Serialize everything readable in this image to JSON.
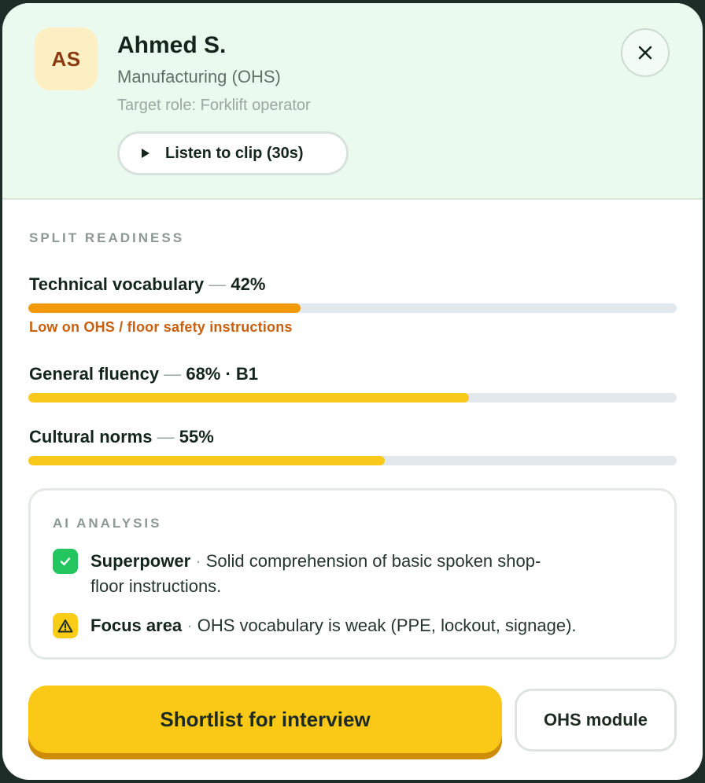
{
  "candidate": {
    "initials": "AS",
    "name": "Ahmed S.",
    "department": "Manufacturing (OHS)",
    "target_role": "Target role: Forklift operator",
    "listen_label": "Listen to clip (30s)"
  },
  "readiness": {
    "title": "SPLIT READINESS",
    "metrics": [
      {
        "label": "Technical vocabulary",
        "dash": "—",
        "value_text": "42%",
        "percent": 42,
        "color": "#f29a0c",
        "note": "Low on OHS / floor safety instructions"
      },
      {
        "label": "General fluency",
        "dash": "—",
        "value_text": "68% · B1",
        "percent": 68,
        "color": "#f9c91b"
      },
      {
        "label": "Cultural norms",
        "dash": "—",
        "value_text": "55%",
        "percent": 55,
        "color": "#f9c91b"
      }
    ]
  },
  "analysis": {
    "title": "AI ANALYSIS",
    "items": [
      {
        "icon": "check-icon",
        "heading": "Superpower",
        "sep": "·",
        "line1": "Solid comprehension of basic spoken shop-",
        "line2": "floor instructions.",
        "badge_color": "#22c55e"
      },
      {
        "icon": "warning-icon",
        "heading": "Focus area",
        "sep": "·",
        "line1": "OHS vocabulary is weak (PPE, lockout, signage).",
        "badge_color": "#facc15"
      }
    ]
  },
  "actions": {
    "primary": "Shortlist for interview",
    "secondary": "OHS module"
  }
}
